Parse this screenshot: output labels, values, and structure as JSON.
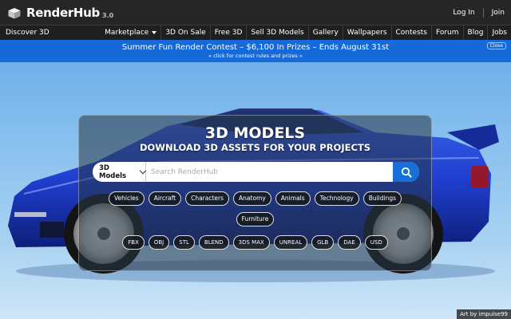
{
  "header": {
    "logo_text": "RenderHub",
    "logo_version": "3.0",
    "login_label": "Log In",
    "join_label": "Join"
  },
  "nav": {
    "discover_label": "Discover 3D",
    "items": [
      {
        "label": "Marketplace"
      },
      {
        "label": "3D On Sale"
      },
      {
        "label": "Free 3D"
      },
      {
        "label": "Sell 3D Models"
      },
      {
        "label": "Gallery"
      },
      {
        "label": "Wallpapers"
      },
      {
        "label": "Contests"
      },
      {
        "label": "Forum"
      },
      {
        "label": "Blog"
      },
      {
        "label": "Jobs"
      }
    ]
  },
  "banner": {
    "title": "Summer Fun Render Contest – $6,100 In Prizes – Ends August 31st",
    "subtitle": "» click for contest rules and prizes «",
    "close_label": "Close"
  },
  "hero": {
    "title": "3D MODELS",
    "subtitle": "DOWNLOAD 3D ASSETS FOR YOUR PROJECTS",
    "search": {
      "category": "3D Models",
      "placeholder": "Search RenderHub"
    },
    "categories_row1": [
      "Vehicles",
      "Aircraft",
      "Characters",
      "Anatomy",
      "Animals",
      "Technology",
      "Buildings"
    ],
    "categories_row2": [
      "Furniture"
    ],
    "formats": [
      "FBX",
      "OBJ",
      "STL",
      "BLEND",
      "3DS MAX",
      "UNREAL",
      "GLB",
      "DAE",
      "USD"
    ],
    "credit": "Art by impulse99"
  },
  "colors": {
    "topbar": "#262626",
    "banner": "#1669d9",
    "search_button": "#1670d8",
    "car_body": "#1f3fd0"
  },
  "icons": {
    "logo": "cube-icon",
    "search": "search-icon",
    "dropdown": "chevron-down-icon"
  }
}
